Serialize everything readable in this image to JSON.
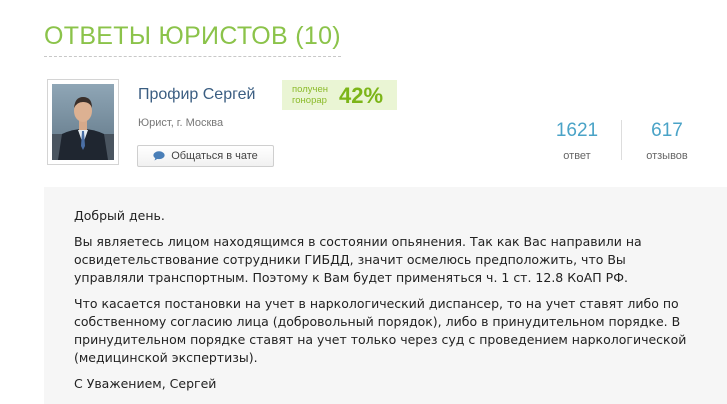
{
  "section": {
    "title": "ОТВЕТЫ ЮРИСТОВ (10)"
  },
  "lawyer": {
    "name": "Профир Сергей",
    "role": "Юрист, г. Москва",
    "fee_label": "получен\nгонорар",
    "fee_value": "42%",
    "chat_button": "Общаться в чате"
  },
  "stats": {
    "answers_value": "1621",
    "answers_label": "ответ",
    "reviews_value": "617",
    "reviews_label": "отзывов"
  },
  "answer": {
    "greeting": "Добрый день.",
    "paragraph1": "Вы являетесь лицом находящимся в состоянии опьянения. Так как Вас направили на освидетельствование сотрудники ГИБДД, значит осмелюсь предположить, что Вы управляли транспортным. Поэтому к Вам будет применяться ч. 1 ст. 12.8 КоАП РФ.",
    "paragraph2": "Что касается постановки на учет в наркологический диспансер, то на учет ставят либо по собственному согласию лица (добровольный порядок), либо в принудительном порядке. В принудительном порядке ставят на учет только через суд с проведением наркологической (медицинской экспертизы).",
    "signature": "С Уважением, Сергей"
  },
  "icons": {
    "chat": "chat-bubble-icon",
    "avatar": "lawyer-photo"
  },
  "colors": {
    "accent_green": "#8bc34a",
    "link_blue": "#3b5e82",
    "stat_blue": "#4aa3c7",
    "fee_bg": "#eaf5d4"
  }
}
